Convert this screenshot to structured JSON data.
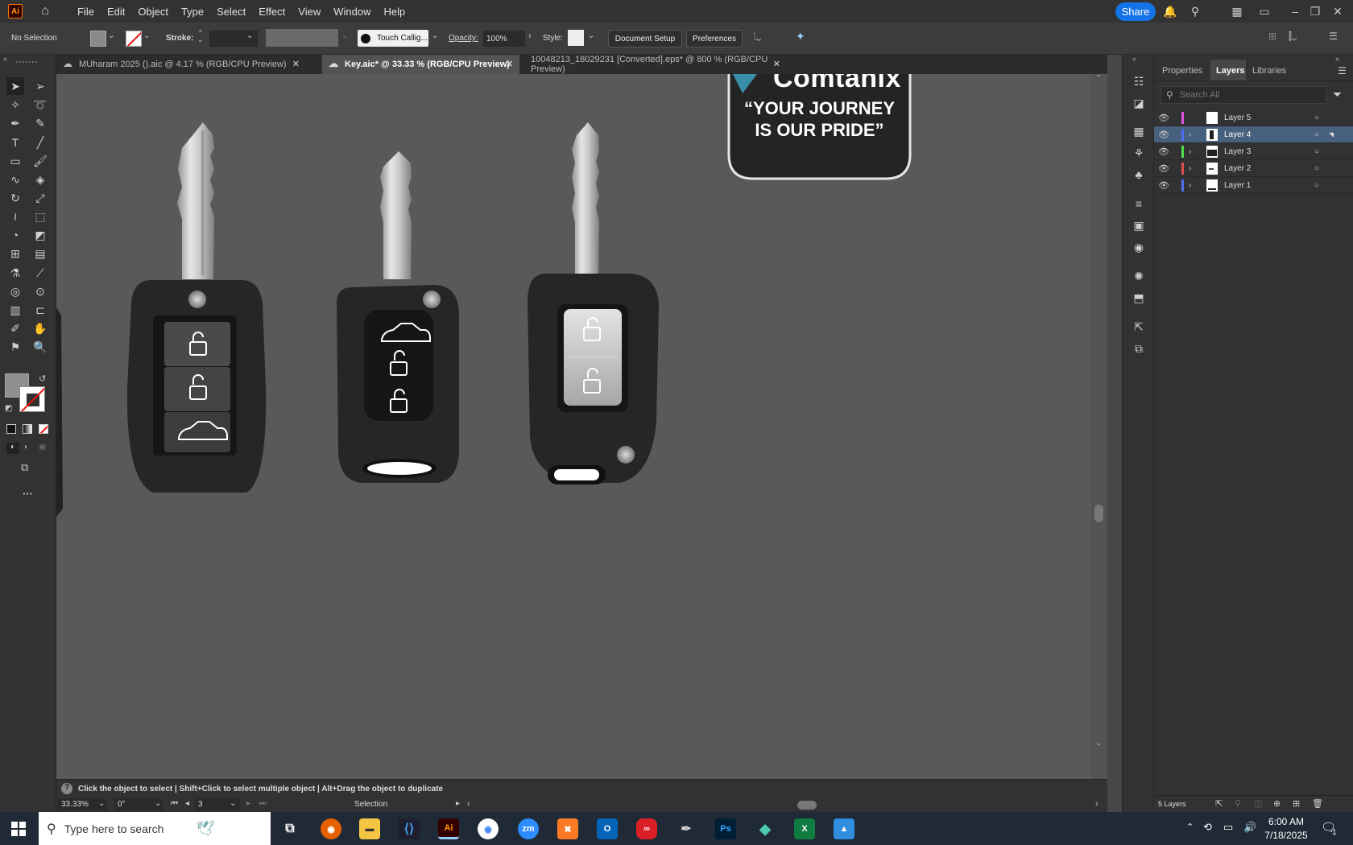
{
  "app": {
    "logo": "Ai",
    "home_icon": "home-icon"
  },
  "menus": [
    "File",
    "Edit",
    "Object",
    "Type",
    "Select",
    "Effect",
    "View",
    "Window",
    "Help"
  ],
  "topbar": {
    "share": "Share"
  },
  "control": {
    "selection": "No Selection",
    "stroke_label": "Stroke:",
    "brush_name": "Touch Callig...",
    "opacity_label": "Opacity:",
    "opacity_value": "100%",
    "style_label": "Style:",
    "document_setup": "Document Setup",
    "preferences": "Preferences"
  },
  "tabs": [
    {
      "label": "MUharam 2025 ().aic @ 4.17 % (RGB/CPU Preview)",
      "active": false
    },
    {
      "label": "Key.aic* @ 33.33 % (RGB/CPU Preview)",
      "active": true
    },
    {
      "label": "10048213_18029231 [Converted].eps* @ 800 % (RGB/CPU Preview)",
      "active": false
    }
  ],
  "artwork": {
    "brand_partial": "Comtanix",
    "slogan_line1": "“YOUR JOURNEY",
    "slogan_line2": "IS OUR PRIDE”"
  },
  "status": {
    "hint": "Click the object to select  |  Shift+Click to select multiple object  |  Alt+Drag the object to duplicate",
    "zoom": "33.33%",
    "rotation": "0°",
    "artboard": "3",
    "tool": "Selection"
  },
  "panel": {
    "tabs": [
      "Properties",
      "Layers",
      "Libraries"
    ],
    "active_tab": "Layers",
    "search_placeholder": "Search All",
    "layers": [
      {
        "name": "Layer 5",
        "color": "#e052e0",
        "selected": false,
        "expandable": false
      },
      {
        "name": "Layer 4",
        "color": "#4f6ff0",
        "selected": true,
        "expandable": true
      },
      {
        "name": "Layer 3",
        "color": "#4fe04f",
        "selected": false,
        "expandable": true
      },
      {
        "name": "Layer 2",
        "color": "#e04f4f",
        "selected": false,
        "expandable": true
      },
      {
        "name": "Layer 1",
        "color": "#4f6ff0",
        "selected": false,
        "expandable": true
      }
    ],
    "layer_count": "5 Layers"
  },
  "taskbar": {
    "search_placeholder": "Type here to search",
    "time": "6:00 AM",
    "date": "7/18/2025",
    "notification_count": "1",
    "apps": [
      "task-view",
      "firefox",
      "file-explorer",
      "vscode",
      "illustrator",
      "chrome",
      "zoom",
      "xampp",
      "outlook",
      "creative-cloud",
      "pen-tool",
      "photoshop",
      "app-diamond",
      "excel",
      "photos"
    ]
  },
  "colors": {
    "accent": "#1473e6",
    "selected_layer": "#46607d",
    "canvas": "#595959"
  }
}
